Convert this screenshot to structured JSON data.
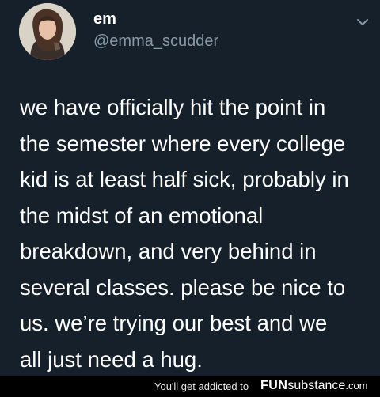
{
  "tweet": {
    "display_name": "em",
    "handle": "@emma_scudder",
    "text_lines": [
      "we have officially hit the point in",
      "the semester where every college",
      "kid is at least half sick, probably in",
      "the midst of an emotional",
      "breakdown, and very behind in",
      "several classes. please be nice to",
      "us. we’re trying our best and we",
      "all just need a hug."
    ]
  },
  "icons": {
    "menu": "chevron-down-icon",
    "avatar": "avatar"
  },
  "footer": {
    "tagline": "You'll get addicted to",
    "brand_fun": "FUN",
    "brand_rest": "substance",
    "brand_tld": ".com"
  },
  "colors": {
    "background": "#15202b",
    "handle": "#8899a6",
    "footer": "#000000"
  }
}
